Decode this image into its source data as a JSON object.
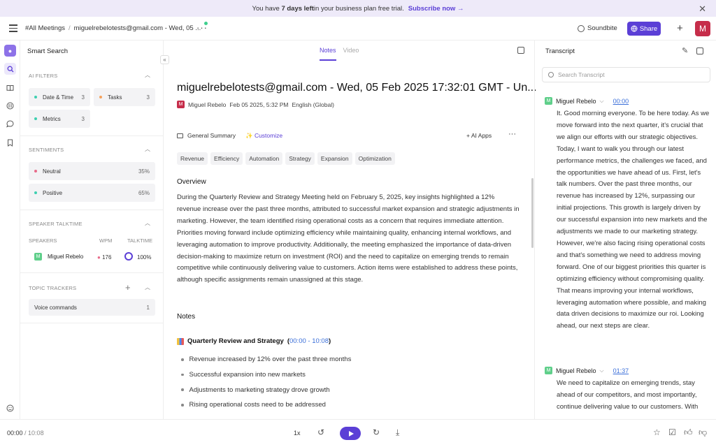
{
  "banner": {
    "pre": "You have ",
    "bold": "7 days left",
    "post": " in your business plan free trial.",
    "subscribe": "Subscribe now →",
    "close": "✕"
  },
  "topbar": {
    "all_meetings": "#All Meetings",
    "separator": "/",
    "meeting_crumb": "miguelrebelotests@gmail.com - Wed, 05 ...",
    "more": "···",
    "soundbite": "Soundbite",
    "share": "Share",
    "add": "+",
    "avatar": "M"
  },
  "left": {
    "title": "Smart Search",
    "ai_filters": {
      "heading": "AI FILTERS",
      "items": [
        {
          "label": "Date & Time",
          "count": "3",
          "color": "#3ecfb0"
        },
        {
          "label": "Tasks",
          "count": "3",
          "color": "#f5a25d"
        },
        {
          "label": "Metrics",
          "count": "3",
          "color": "#3ecfb0"
        }
      ]
    },
    "sentiments": {
      "heading": "SENTIMENTS",
      "items": [
        {
          "label": "Neutral",
          "value": "35%",
          "color": "#e86b8a"
        },
        {
          "label": "Positive",
          "value": "65%",
          "color": "#3ecfb0"
        }
      ]
    },
    "talktime": {
      "heading": "SPEAKER TALKTIME",
      "col_speakers": "SPEAKERS",
      "col_wpm": "WPM",
      "col_talktime": "TALKTIME",
      "speaker_avatar": "M",
      "speaker": "Miguel Rebelo",
      "wpm": "176",
      "talktime": "100%",
      "talktime_fraction": 1.0
    },
    "topics": {
      "heading": "TOPIC TRACKERS",
      "add": "+",
      "items": [
        {
          "label": "Voice commands",
          "count": "1"
        }
      ]
    }
  },
  "main": {
    "tabs": {
      "notes": "Notes",
      "video": "Video"
    },
    "title": "miguelrebelotests@gmail.com - Wed, 05 Feb 2025 17:32:01 GMT - Un...",
    "meta": {
      "avatar": "M",
      "author": "Miguel Rebelo",
      "date": "Feb 05 2025, 5:32 PM",
      "language": "English (Global)"
    },
    "toolbar": {
      "summary": "General Summary",
      "customize": "✨ Customize",
      "ai_apps": "+ AI Apps",
      "more": "···"
    },
    "tags": [
      "Revenue",
      "Efficiency",
      "Automation",
      "Strategy",
      "Expansion",
      "Optimization"
    ],
    "overview_heading": "Overview",
    "overview": "During the Quarterly Review and Strategy Meeting held on February 5, 2025, key insights highlighted a 12% revenue increase over the past three months, attributed to successful market expansion and strategic adjustments in marketing. However, the team identified rising operational costs as a concern that requires immediate attention. Priorities moving forward include optimizing efficiency while maintaining quality, enhancing internal workflows, and leveraging automation to improve productivity. Additionally, the meeting emphasized the importance of data-driven decision-making to maximize return on investment (ROI) and the need to capitalize on emerging trends to remain competitive while continuously delivering value to customers. Action items were established to address these points, although specific assignments remain unassigned at this stage.",
    "notes_heading": "Notes",
    "section_title": "Quarterly Review and Strategy",
    "section_open": "(",
    "section_range": "00:00 - 10:08",
    "section_close": ")",
    "bullets": [
      "Revenue increased by 12% over the past three months",
      "Successful expansion into new markets",
      "Adjustments to marketing strategy drove growth",
      "Rising operational costs need to be addressed"
    ]
  },
  "transcript": {
    "title": "Transcript",
    "search_placeholder": "Search Transcript",
    "entries": [
      {
        "speaker": "Miguel Rebelo",
        "avatar": "M",
        "time": "00:00",
        "text": "It. Good morning everyone. To be here today. As we move forward into the next quarter, it's crucial that we align our efforts with our strategic objectives. Today, I want to walk you through our latest performance metrics, the challenges we faced, and the opportunities we have ahead of us. First, let's talk numbers. Over the past three months, our revenue has increased by 12%, surpassing our initial projections. This growth is largely driven by our successful expansion into new markets and the adjustments we made to our marketing strategy. However, we're also facing rising operational costs and that's something we need to address moving forward. One of our biggest priorities this quarter is optimizing efficiency without compromising quality. That means improving your internal workflows, leveraging automation where possible, and making data driven decisions to maximize our roi. Looking ahead, our next steps are clear."
      },
      {
        "speaker": "Miguel Rebelo",
        "avatar": "M",
        "time": "01:37",
        "text": "We need to capitalize on emerging trends, stay ahead of our competitors, and most importantly, continue delivering value to our customers. With"
      }
    ]
  },
  "player": {
    "current": "00:00",
    "separator": " / ",
    "total": "10:08",
    "speed": "1x"
  },
  "colors": {
    "accent": "#5b3fd6",
    "avatar_red": "#c62d4a",
    "avatar_green": "#5fcf8a"
  }
}
